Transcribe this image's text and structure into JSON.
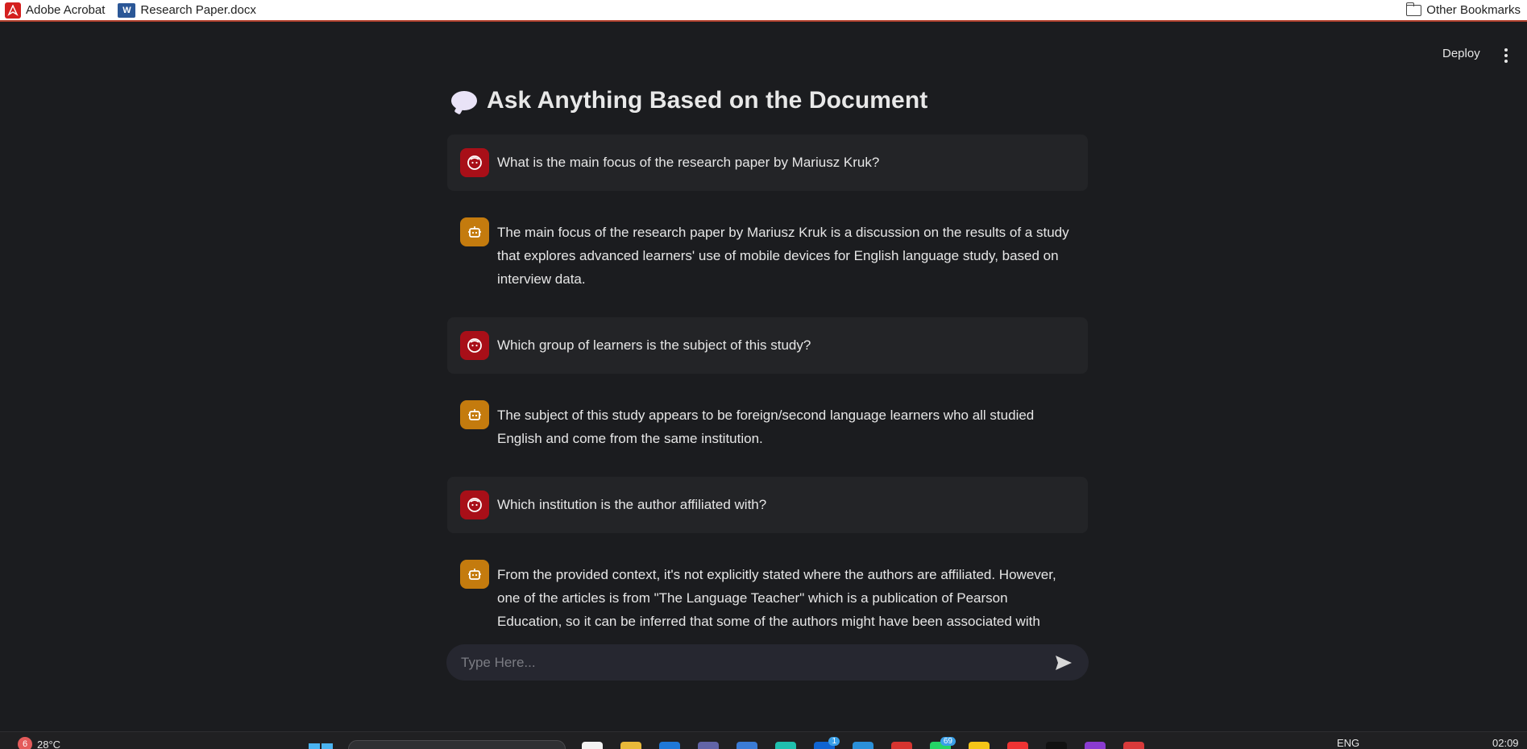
{
  "bookmarks": {
    "items": [
      {
        "label": "Adobe Acrobat",
        "icon": "adobe-acrobat-icon"
      },
      {
        "label": "Research Paper.docx",
        "icon": "word-doc-icon"
      }
    ],
    "other": {
      "label": "Other Bookmarks",
      "icon": "folder-icon"
    }
  },
  "header": {
    "deploy_label": "Deploy",
    "menu_icon": "kebab-menu-icon"
  },
  "page": {
    "title": "Ask Anything Based on the Document",
    "title_icon": "speech-bubble-icon"
  },
  "messages": [
    {
      "role": "user",
      "text": "What is the main focus of the research paper by Mariusz Kruk?"
    },
    {
      "role": "assistant",
      "text": "The main focus of the research paper by Mariusz Kruk is a discussion on the results of a study that explores advanced learners' use of mobile devices for English language study, based on interview data."
    },
    {
      "role": "user",
      "text": "Which group of learners is the subject of this study?"
    },
    {
      "role": "assistant",
      "text": "The subject of this study appears to be foreign/second language learners who all studied English and come from the same institution."
    },
    {
      "role": "user",
      "text": "Which institution is the author affiliated with?"
    },
    {
      "role": "assistant",
      "text": "From the provided context, it's not explicitly stated where the authors are affiliated. However, one of the articles is from \"The Language Teacher\" which is a publication of Pearson Education, so it can be inferred that some of the authors might have been associated with Pearson Education at"
    }
  ],
  "chat_input": {
    "placeholder": "Type Here...",
    "send_icon": "send-icon"
  },
  "taskbar": {
    "weather_badge": "6",
    "temperature": "28°C",
    "language": "ENG",
    "time": "02:09",
    "app_badges": {
      "outlook": "1",
      "whatsapp": "69"
    }
  },
  "colors": {
    "background": "#1b1c1f",
    "user_avatar": "#a80f18",
    "assistant_avatar": "#c47b0e",
    "user_bubble": "#232427",
    "input_bg": "#262730"
  }
}
